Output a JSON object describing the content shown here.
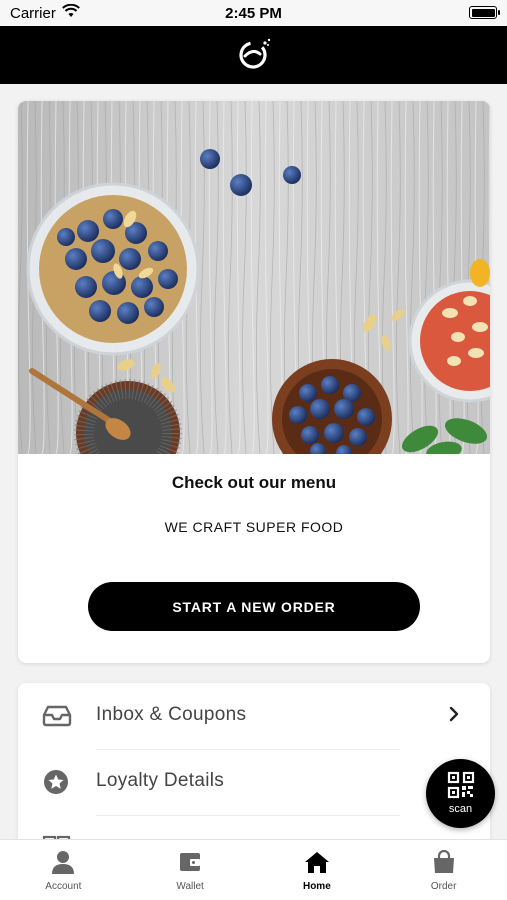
{
  "status_bar": {
    "carrier": "Carrier",
    "time": "2:45 PM"
  },
  "header": {
    "logo_icon": "brand-logo-icon"
  },
  "promo": {
    "title": "Check out our menu",
    "subtitle": "WE CRAFT SUPER FOOD",
    "button_label": "START A NEW ORDER"
  },
  "menu": {
    "items": [
      {
        "label": "Inbox & Coupons",
        "icon": "inbox-icon",
        "has_chevron": true
      },
      {
        "label": "Loyalty Details",
        "icon": "star-badge-icon",
        "has_chevron": false
      },
      {
        "label": "",
        "icon": "grid-icon",
        "has_chevron": false
      }
    ]
  },
  "scan_button": {
    "label": "scan",
    "icon": "qr-code-icon"
  },
  "tab_bar": {
    "tabs": [
      {
        "label": "Account",
        "icon": "person-icon",
        "active": false
      },
      {
        "label": "Wallet",
        "icon": "wallet-icon",
        "active": false
      },
      {
        "label": "Home",
        "icon": "home-icon",
        "active": true
      },
      {
        "label": "Order",
        "icon": "shopping-bag-icon",
        "active": false
      }
    ]
  },
  "colors": {
    "header_background": "#000000",
    "primary_button": "#000000",
    "page_background": "#f2f2f2",
    "text_muted": "#444444"
  }
}
